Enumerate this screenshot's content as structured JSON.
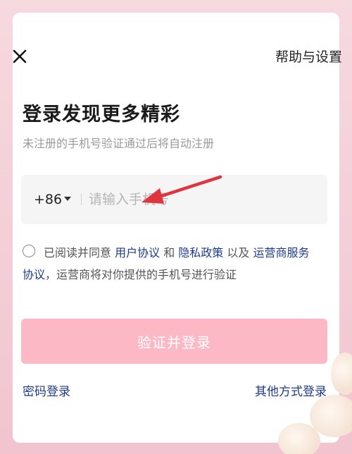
{
  "header": {
    "close_icon": "close-icon",
    "help_label": "帮助与设置"
  },
  "title": "登录发现更多精彩",
  "subtitle": "未注册的手机号验证通过后将自动注册",
  "phone": {
    "country_code": "+86",
    "value": "",
    "placeholder": "请输入手机号"
  },
  "agreement": {
    "prefix": "已阅读并同意 ",
    "user_agreement": "用户协议",
    "and": " 和 ",
    "privacy_policy": "隐私政策",
    "and2": " 以及 ",
    "operator_agreement": "运营商服务协议",
    "suffix": "，运营商将对你提供的手机号进行验证",
    "checked": false
  },
  "login_button": "验证并登录",
  "footer": {
    "password_login": "密码登录",
    "other_login": "其他方式登录"
  },
  "colors": {
    "accent": "#fdb8c6",
    "link": "#1e3a8a",
    "annotation_arrow": "#e0343f"
  }
}
